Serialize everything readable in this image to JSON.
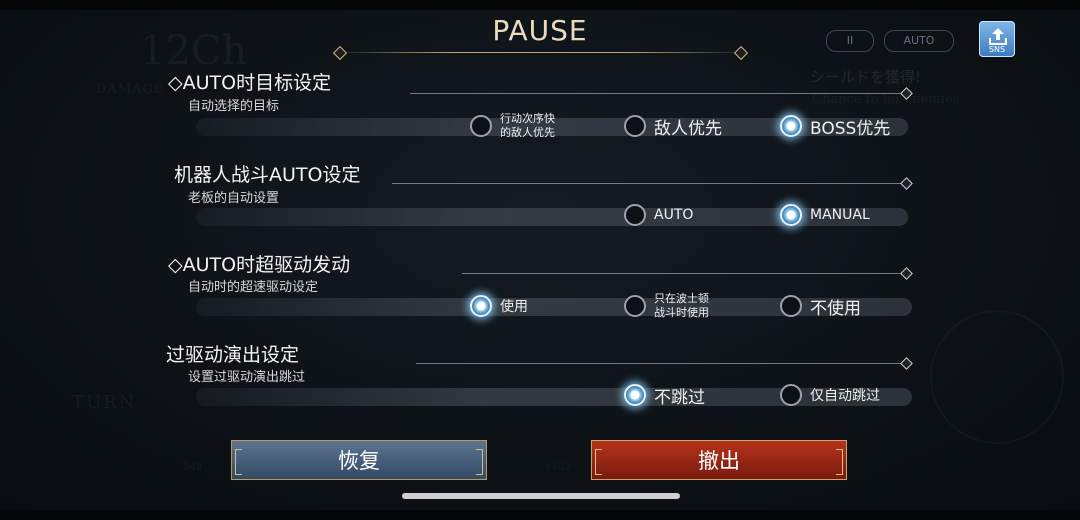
{
  "header": {
    "title": "PAUSE",
    "bg_pause_glyph": "II",
    "bg_auto_label": "AUTO",
    "sns_label": "SNS"
  },
  "background": {
    "stage_text": "12Ch",
    "damage_text": "DAMAGE",
    "turn_text": "TURN",
    "jp_text": "シールドを獲得!",
    "sub_text": "Chance to hit enemies",
    "hp_a": "548",
    "hp_b": "1102"
  },
  "sections": [
    {
      "title": "◇AUTO时目标设定",
      "subtitle": "自动选择的目标",
      "options": [
        {
          "label": "行动次序快\n的敌人优先",
          "selected": false
        },
        {
          "label": "敌人优先",
          "selected": false
        },
        {
          "label": "BOSS优先",
          "selected": true
        }
      ]
    },
    {
      "title": "机器人战斗AUTO设定",
      "subtitle": "老板的自动设置",
      "options": [
        {
          "label": "AUTO",
          "selected": false
        },
        {
          "label": "MANUAL",
          "selected": true
        }
      ]
    },
    {
      "title": "◇AUTO时超驱动发动",
      "subtitle": "自动时的超速驱动设定",
      "options": [
        {
          "label": "使用",
          "selected": true
        },
        {
          "label": "只在波士顿\n战斗时使用",
          "selected": false
        },
        {
          "label": "不使用",
          "selected": false
        }
      ]
    },
    {
      "title": "过驱动演出设定",
      "subtitle": "设置过驱动演出跳过",
      "options": [
        {
          "label": "不跳过",
          "selected": true
        },
        {
          "label": "仅自动跳过",
          "selected": false
        }
      ]
    }
  ],
  "buttons": {
    "resume": "恢复",
    "quit": "撤出"
  },
  "colors": {
    "accent_gold": "#c8aa6e",
    "resume_blue": "#4a6280",
    "quit_red": "#a02a16",
    "radio_glow": "#9fd0f2"
  }
}
